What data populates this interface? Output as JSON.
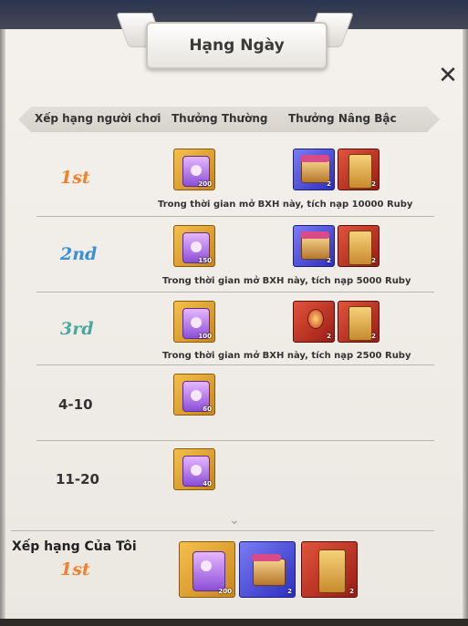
{
  "title": "Hạng Ngày",
  "headers": [
    "Xếp hạng người chơi",
    "Thưởng Thường",
    "Thưởng Nâng Bậc"
  ],
  "rows": [
    {
      "rank": "1st",
      "rank_color": "#f0822a",
      "normal_qty": "200",
      "upgrade_qtys": [
        "2",
        "2"
      ],
      "note": "Trong thời gian mở BXH này, tích nạp 10000 Ruby"
    },
    {
      "rank": "2nd",
      "rank_color": "#3a8fd8",
      "normal_qty": "150",
      "upgrade_qtys": [
        "2",
        "2"
      ],
      "note": "Trong thời gian mở BXH này, tích nạp 5000 Ruby"
    },
    {
      "rank": "3rd",
      "rank_color": "#4aa8a0",
      "normal_qty": "100",
      "upgrade_qtys": [
        "2",
        "2"
      ],
      "note": "Trong thời gian mở BXH này, tích nạp 2500 Ruby"
    },
    {
      "rank": "4-10",
      "normal_qty": "60"
    },
    {
      "rank": "11-20",
      "normal_qty": "40"
    }
  ],
  "my_rank": {
    "label": "Xếp hạng Của Tôi",
    "rank": "1st",
    "rank_color": "#f0822a",
    "qtys": [
      "200",
      "2",
      "2"
    ]
  },
  "icons": {
    "close": "close-icon",
    "more": "chevron-down-icon"
  }
}
